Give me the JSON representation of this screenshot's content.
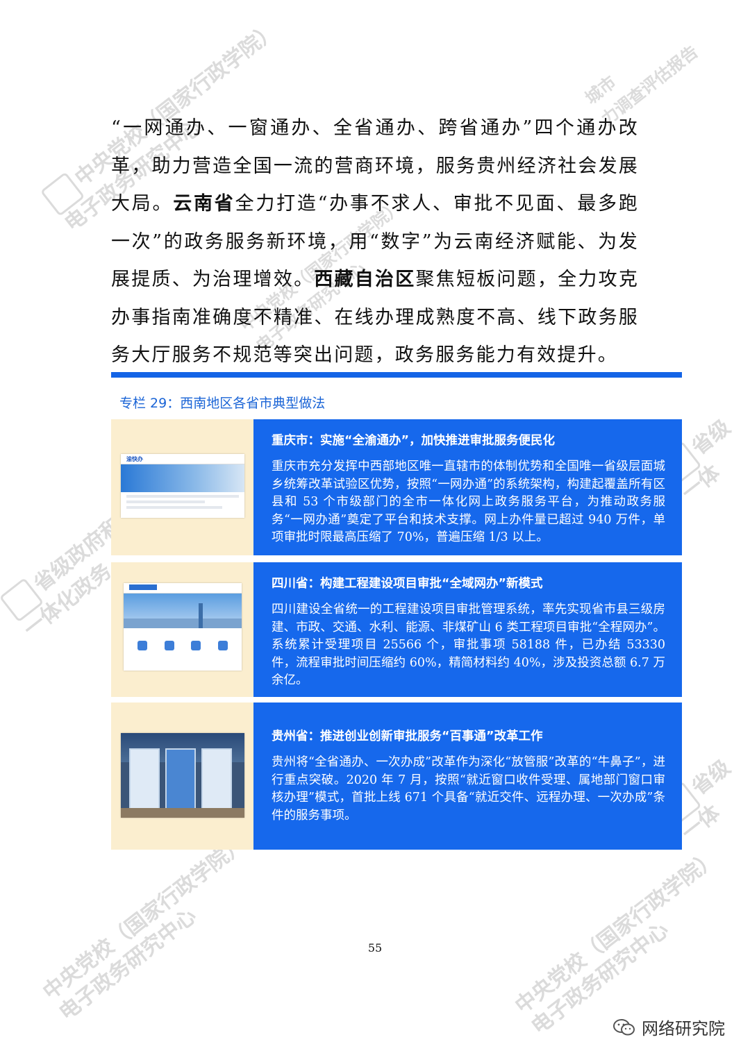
{
  "watermark": {
    "line1": "中央党校（国家行政学院）",
    "line2": "电子政务研究中心",
    "side1": "省级政府和重",
    "side2": "一体化政务",
    "top_right1": "城市",
    "top_right2": "力调查评估报告",
    "right1": "省级",
    "right2": "一体"
  },
  "intro": {
    "p1": "“一网通办、一窗通办、全省通办、跨省通办”四个通办改革，助力营造全国一流的营商环境，服务贵州经济社会发展大局。",
    "yunnan_label": "云南省",
    "p2": "全力打造“办事不求人、审批不见面、最多跑一次”的政务服务新环境，用“数字”为云南经济赋能、为发展提质、为治理增效。",
    "tibet_label": "西藏自治区",
    "p3": "聚焦短板问题，全力攻克办事指南准确度不精准、在线办理成熟度不高、线下政务服务大厅服务不规范等突出问题，政务服务能力有效提升。"
  },
  "column": {
    "title": "专栏 29：西南地区各省市典型做法"
  },
  "cases": [
    {
      "title": "重庆市：实施“全渝通办”，加快推进审批服务便民化",
      "body": "重庆市充分发挥中西部地区唯一直辖市的体制优势和全国唯一省级层面城乡统筹改革试验区优势，按照“一网办通”的系统架构，构建起覆盖所有区县和 53 个市级部门的全市一体化网上政务服务平台，为推动政务服务“一网办通”奠定了平台和技术支撑。网上办件量已超过 940 万件，单项审批时限最高压缩了 70%，普遍压缩 1/3 以上。",
      "image": "chongqing-portal-screenshot"
    },
    {
      "title": "四川省：构建工程建设项目审批“全域网办”新模式",
      "body": "四川建设全省统一的工程建设项目审批管理系统，率先实现省市县三级房建、市政、交通、水利、能源、非煤矿山 6 类工程项目审批“全程网办”。系统累计受理项目 25566 个，审批事项 58188 件，已办结 53330 件，流程审批时间压缩约 60%，精简材料约 40%，涉及投资总额 6.7 万余亿。",
      "image": "sichuan-portal-screenshot"
    },
    {
      "title": "贵州省：推进创业创新审批服务“百事通”改革工作",
      "body": "贵州将“全省通办、一次办成”改革作为深化“放管服”改革的“牛鼻子”，进行重点突破。2020 年 7 月，按照“就近窗口收件受理、属地部门窗口审核办理”模式，首批上线 671 个具备“就近交件、远程办理、一次办成”条件的服务事项。",
      "image": "guizhou-service-hall-photo"
    }
  ],
  "thumb1": {
    "logo": "渝快办"
  },
  "page_number": "55",
  "footer": {
    "brand": "网络研究院",
    "icon": "wechat-icon"
  },
  "colors": {
    "accent": "#1668ec",
    "rule": "#1464e6",
    "image_bg": "#fbeecf",
    "title": "#1a64d6"
  }
}
